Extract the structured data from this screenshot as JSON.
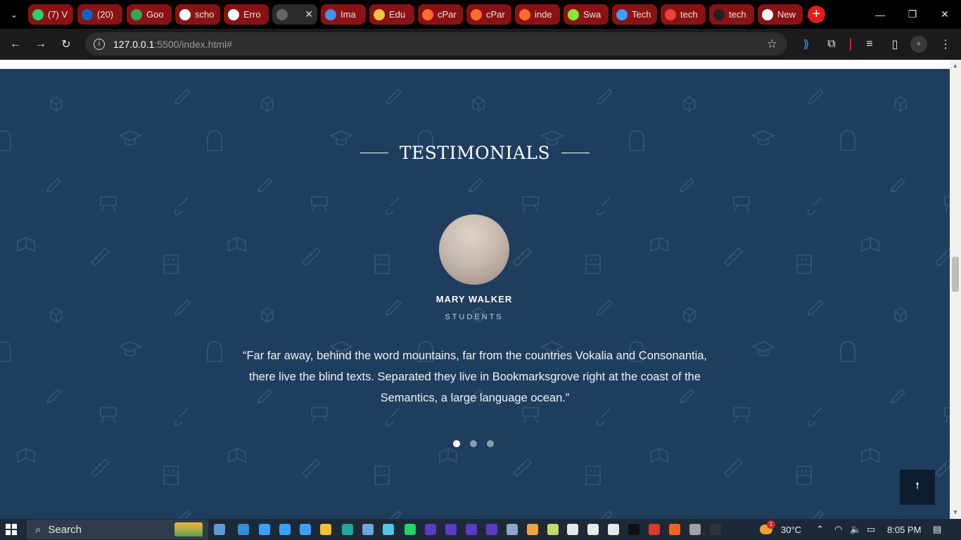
{
  "tabs": [
    {
      "label": "(7) V",
      "favicon": "whatsapp-icon",
      "color": "#25d366"
    },
    {
      "label": "(20)",
      "favicon": "linkedin-icon",
      "color": "#0a66c2"
    },
    {
      "label": "Goo",
      "favicon": "google-meet-icon",
      "color": "#34a853"
    },
    {
      "label": "scho",
      "favicon": "google-icon",
      "color": "#ffffff"
    },
    {
      "label": "Erro",
      "favicon": "google-icon",
      "color": "#ffffff"
    },
    {
      "label": "",
      "favicon": "globe-icon",
      "color": "#666666",
      "active": true
    },
    {
      "label": "Ima",
      "favicon": "image-icon",
      "color": "#4a90e2"
    },
    {
      "label": "Edu",
      "favicon": "edu-icon",
      "color": "#f4c542"
    },
    {
      "label": "cPar",
      "favicon": "cpanel-icon",
      "color": "#ff6c2c"
    },
    {
      "label": "cPar",
      "favicon": "cpanel-icon",
      "color": "#ff6c2c"
    },
    {
      "label": "inde",
      "favicon": "cpanel-icon",
      "color": "#ff6c2c"
    },
    {
      "label": "Swa",
      "favicon": "swagger-icon",
      "color": "#85ea2d"
    },
    {
      "label": "Tech",
      "favicon": "tech-icon",
      "color": "#3aa0ff"
    },
    {
      "label": "tech",
      "favicon": "gmail-icon",
      "color": "#ea4335"
    },
    {
      "label": "tech",
      "favicon": "github-icon",
      "color": "#222222"
    },
    {
      "label": "New",
      "favicon": "chrome-icon",
      "color": "#ffffff"
    }
  ],
  "toolbar": {
    "url_host": "127.0.0.1",
    "url_path": ":5500/index.html#"
  },
  "section": {
    "title": "TESTIMONIALS"
  },
  "testimonial": {
    "name": "MARY WALKER",
    "role": "STUDENTS",
    "quote": "“Far far away, behind the word mountains, far from the countries Vokalia and Consonantia, there live the blind texts. Separated they live in Bookmarksgrove right at the coast of the Semantics, a large language ocean.”",
    "slide_count": 3,
    "active_slide": 1
  },
  "taskbar": {
    "search_label": "Search",
    "temperature": "30°C",
    "time": "8:05 PM",
    "weather_badge": "1"
  }
}
